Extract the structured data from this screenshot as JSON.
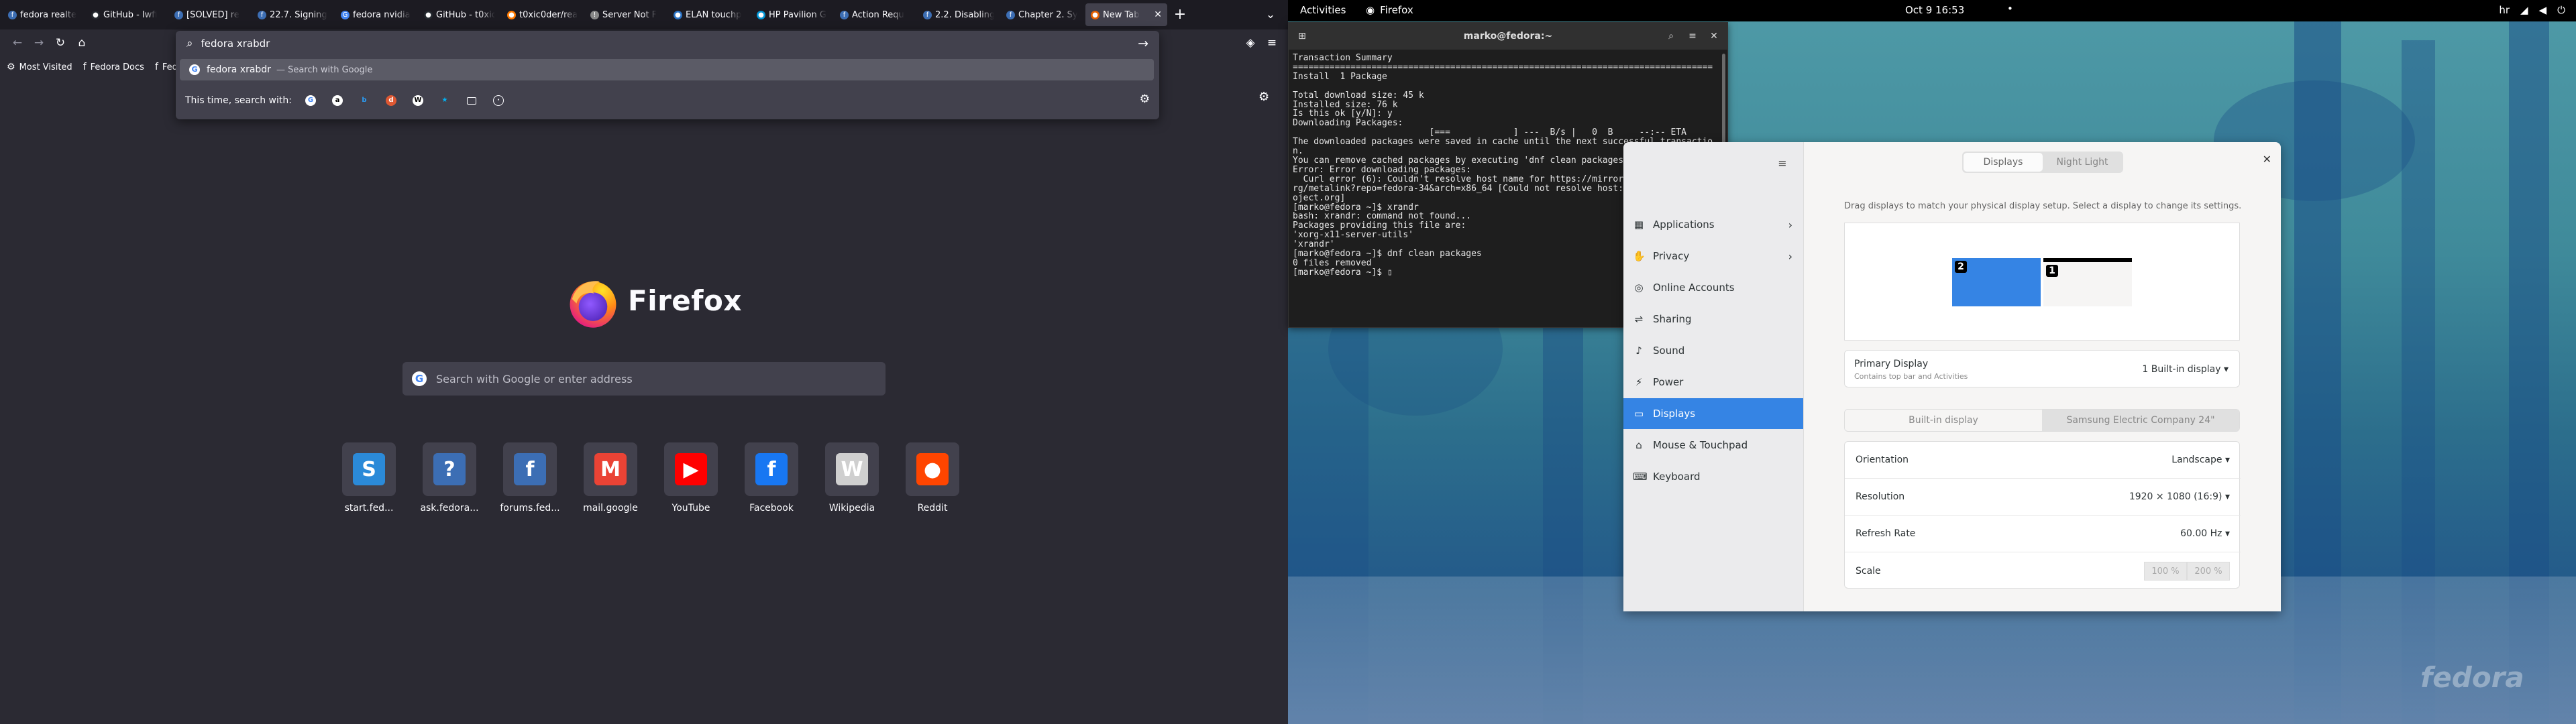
{
  "firefox": {
    "tabs": [
      {
        "label": "fedora realte",
        "color": "#3c6eb4",
        "glyph": "f"
      },
      {
        "label": "GitHub - lwfi",
        "color": "#24292f",
        "glyph": "●"
      },
      {
        "label": "[SOLVED] re",
        "color": "#3c6eb4",
        "glyph": "f"
      },
      {
        "label": "22.7. Signing",
        "color": "#3c6eb4",
        "glyph": "f"
      },
      {
        "label": "fedora nvidia",
        "color": "#4285f4",
        "glyph": "G"
      },
      {
        "label": "GitHub - t0xic0",
        "color": "#24292f",
        "glyph": "●"
      },
      {
        "label": "t0xic0der/rea",
        "color": "#ff7a00",
        "glyph": "●"
      },
      {
        "label": "Server Not F",
        "color": "#888888",
        "glyph": "!"
      },
      {
        "label": "ELAN touchp",
        "color": "#2a73c5",
        "glyph": "●"
      },
      {
        "label": "HP Pavilion G",
        "color": "#0096d6",
        "glyph": "●"
      },
      {
        "label": "Action Requ",
        "color": "#3c6eb4",
        "glyph": "f"
      },
      {
        "label": "2.2. Disabling",
        "color": "#3c6eb4",
        "glyph": "f"
      },
      {
        "label": "Chapter 2. Sy",
        "color": "#3c6eb4",
        "glyph": "f"
      },
      {
        "label": "New Tab",
        "color": "#e66000",
        "glyph": "●",
        "active": true
      }
    ],
    "new_tab_button": "+",
    "url_value": "fedora xrabdr",
    "go_arrow": "→",
    "suggestion": {
      "text": "fedora xrabdr",
      "hint": "— Search with Google"
    },
    "search_with_label": "This time, search with:",
    "bookmarks": [
      {
        "label": "Most Visited",
        "icon": "⚙"
      },
      {
        "label": "Fedora Docs",
        "icon": "f"
      },
      {
        "label": "Fedora",
        "icon": "f"
      }
    ],
    "brand": "Firefox",
    "search_placeholder": "Search with Google or enter address",
    "shortcuts": [
      {
        "name": "start.fed...",
        "letter": "S",
        "bg": "#2b8ad8"
      },
      {
        "name": "ask.fedora...",
        "letter": "?",
        "bg": "#3c6eb4"
      },
      {
        "name": "forums.fed...",
        "letter": "f",
        "bg": "#3c6eb4"
      },
      {
        "name": "mail.google",
        "letter": "M",
        "bg": "#ea4335"
      },
      {
        "name": "YouTube",
        "letter": "▶",
        "bg": "#ff0000"
      },
      {
        "name": "Facebook",
        "letter": "f",
        "bg": "#1877f2"
      },
      {
        "name": "Wikipedia",
        "letter": "W",
        "bg": "#cfcfcf"
      },
      {
        "name": "Reddit",
        "letter": "●",
        "bg": "#ff4500"
      }
    ]
  },
  "topbar": {
    "activities": "Activities",
    "app": "Firefox",
    "clock": "Oct 9  16:53",
    "lang": "hr",
    "indicators": "⏻"
  },
  "terminal": {
    "title": "marko@fedora:~",
    "text": "Transaction Summary\n================================================================================\nInstall  1 Package\n\nTotal download size: 45 k\nInstalled size: 76 k\nIs this ok [y/N]: y\nDownloading Packages:\n                          [===            ] ---  B/s |   0  B     --:-- ETA\nThe downloaded packages were saved in cache until the next successful transactio\nn.\nYou can remove cached packages by executing 'dnf clean packages'.\nError: Error downloading packages:\n  Curl error (6): Couldn't resolve host name for https://mirrors.fedoraproject.o\nrg/metalink?repo=fedora-34&arch=x86_64 [Could not resolve host: mirrors.fedorapr\noject.org]\n[marko@fedora ~]$ xrandr\nbash: xrandr: command not found...\nPackages providing this file are:\n'xorg-x11-server-utils'\n'xrandr'\n[marko@fedora ~]$ dnf clean packages\n0 files removed\n[marko@fedora ~]$ ▯"
  },
  "settings": {
    "tabs": [
      "Displays",
      "Night Light"
    ],
    "sidebar": [
      {
        "label": "Applications",
        "icon": "▦",
        "chevron": true
      },
      {
        "label": "Privacy",
        "icon": "✋",
        "chevron": true
      },
      {
        "label": "Online Accounts",
        "icon": "◎"
      },
      {
        "label": "Sharing",
        "icon": "⇌"
      },
      {
        "label": "Sound",
        "icon": "♪"
      },
      {
        "label": "Power",
        "icon": "⚡"
      },
      {
        "label": "Displays",
        "icon": "▭",
        "selected": true
      },
      {
        "label": "Mouse & Touchpad",
        "icon": "⌂"
      },
      {
        "label": "Keyboard",
        "icon": "⌨"
      }
    ],
    "arrange_hint": "Drag displays to match your physical display setup. Select a display to change its settings.",
    "monitor_a": "2",
    "monitor_b": "1",
    "primary": {
      "title": "Primary Display",
      "sub": "Contains top bar and Activities",
      "value": "1   Built-in display"
    },
    "display_tabs": [
      "Built-in display",
      "Samsung Electric Company 24\""
    ],
    "rows": [
      {
        "label": "Orientation",
        "value": "Landscape"
      },
      {
        "label": "Resolution",
        "value": "1920 × 1080 (16:9)"
      },
      {
        "label": "Refresh Rate",
        "value": "60.00 Hz"
      }
    ],
    "scale": {
      "label": "Scale",
      "options": [
        "100 %",
        "200 %"
      ]
    }
  },
  "desktop": {
    "watermark": "fedora"
  }
}
